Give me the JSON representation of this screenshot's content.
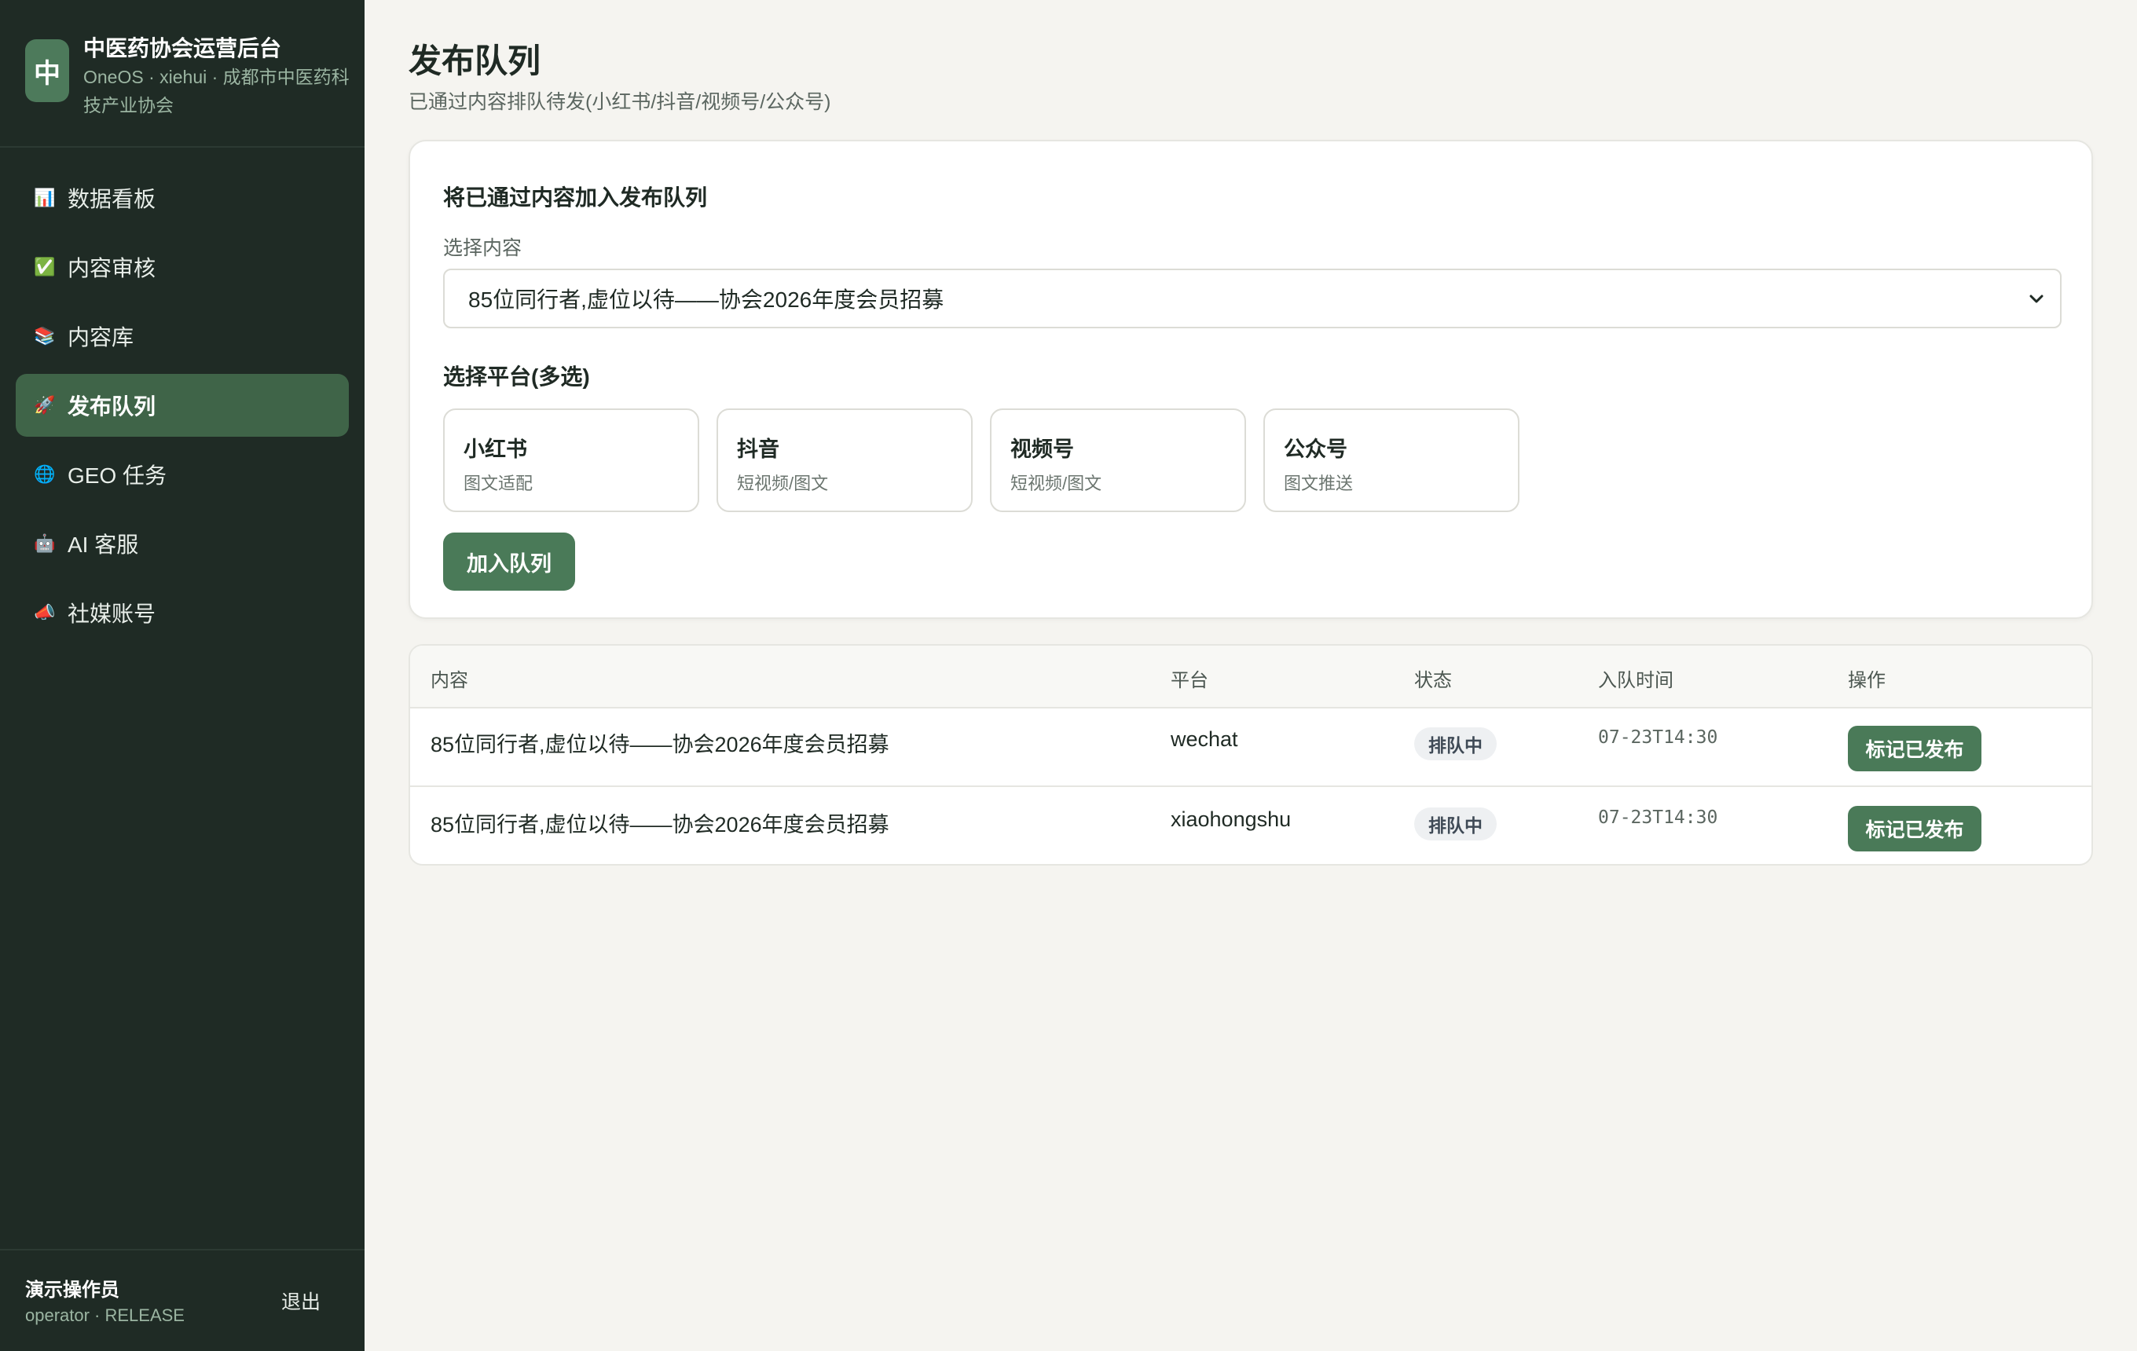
{
  "sidebar": {
    "logo_char": "中",
    "title": "中医药协会运营后台",
    "subtitle": "OneOS · xiehui · 成都市中医药科技产业协会",
    "items": [
      {
        "icon": "📊",
        "icon_name": "chart-icon",
        "label": "数据看板",
        "active": false
      },
      {
        "icon": "✅",
        "icon_name": "check-icon",
        "label": "内容审核",
        "active": false
      },
      {
        "icon": "📚",
        "icon_name": "books-icon",
        "label": "内容库",
        "active": false
      },
      {
        "icon": "🚀",
        "icon_name": "rocket-icon",
        "label": "发布队列",
        "active": true
      },
      {
        "icon": "🌐",
        "icon_name": "globe-icon",
        "label": "GEO 任务",
        "active": false
      },
      {
        "icon": "🤖",
        "icon_name": "robot-icon",
        "label": "AI 客服",
        "active": false
      },
      {
        "icon": "📣",
        "icon_name": "megaphone-icon",
        "label": "社媒账号",
        "active": false
      }
    ],
    "user": {
      "name": "演示操作员",
      "role": "operator · RELEASE",
      "logout_label": "退出"
    }
  },
  "main": {
    "title": "发布队列",
    "subtitle": "已通过内容排队待发(小红书/抖音/视频号/公众号)",
    "form": {
      "title": "将已通过内容加入发布队列",
      "select_label": "选择内容",
      "selected_content": "85位同行者,虚位以待——协会2026年度会员招募",
      "platform_label": "选择平台(多选)",
      "platforms": [
        {
          "name": "小红书",
          "desc": "图文适配"
        },
        {
          "name": "抖音",
          "desc": "短视频/图文"
        },
        {
          "name": "视频号",
          "desc": "短视频/图文"
        },
        {
          "name": "公众号",
          "desc": "图文推送"
        }
      ],
      "submit_label": "加入队列"
    },
    "table": {
      "columns": [
        "内容",
        "平台",
        "状态",
        "入队时间",
        "操作"
      ],
      "rows": [
        {
          "content": "85位同行者,虚位以待——协会2026年度会员招募",
          "platform": "wechat",
          "status": "排队中",
          "time": "07-23T14:30",
          "action": "标记已发布"
        },
        {
          "content": "85位同行者,虚位以待——协会2026年度会员招募",
          "platform": "xiaohongshu",
          "status": "排队中",
          "time": "07-23T14:30",
          "action": "标记已发布"
        }
      ]
    }
  },
  "colors": {
    "sidebar_bg": "#1f2b25",
    "accent": "#4a7a58",
    "active_nav": "#3f6448",
    "page_bg": "#f5f4f0"
  }
}
